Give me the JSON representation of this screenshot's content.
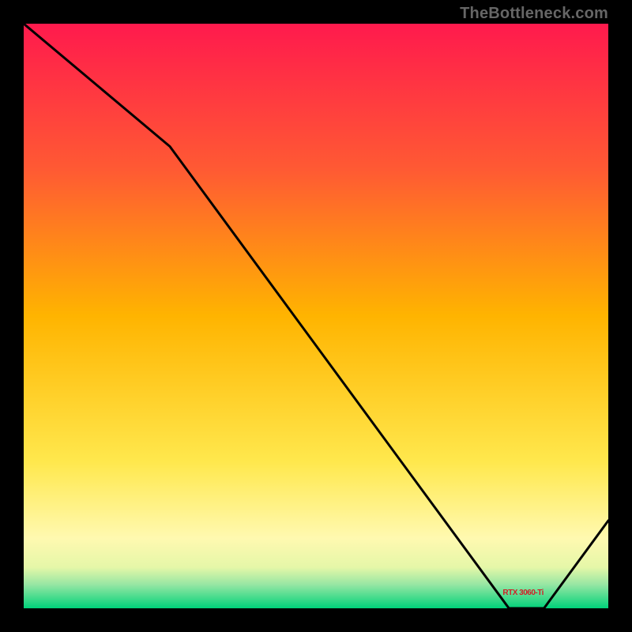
{
  "watermark": "TheBottleneck.com",
  "red_label": "RTX 3060-Ti",
  "chart_data": {
    "type": "line",
    "title": "",
    "xlabel": "",
    "ylabel": "",
    "xlim": [
      0,
      100
    ],
    "ylim": [
      0,
      100
    ],
    "grid": false,
    "series": [
      {
        "name": "curve",
        "x": [
          0,
          25,
          83,
          89,
          100
        ],
        "y": [
          100,
          79,
          0,
          0,
          15
        ]
      }
    ],
    "gradient_stops": [
      {
        "pos": 0.0,
        "color": "#ff1a4d"
      },
      {
        "pos": 0.25,
        "color": "#ff5a33"
      },
      {
        "pos": 0.5,
        "color": "#ffb400"
      },
      {
        "pos": 0.75,
        "color": "#ffe84d"
      },
      {
        "pos": 0.88,
        "color": "#fff9b0"
      },
      {
        "pos": 0.93,
        "color": "#e5f7a8"
      },
      {
        "pos": 0.96,
        "color": "#95e6a3"
      },
      {
        "pos": 1.0,
        "color": "#00d27a"
      }
    ],
    "annotations": [
      {
        "text_key": "red_label",
        "x": 86,
        "y": 2
      }
    ]
  }
}
